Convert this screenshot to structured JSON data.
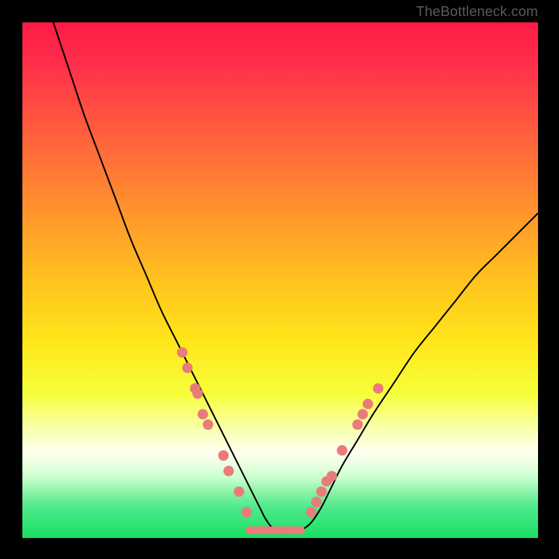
{
  "watermark": "TheBottleneck.com",
  "colors": {
    "frame": "#000000",
    "curve": "#000000",
    "dot_fill": "#e97c7a",
    "dot_stroke": "#d96a68",
    "gradient_stops": [
      {
        "offset": 0.0,
        "color": "#ff1a46"
      },
      {
        "offset": 0.08,
        "color": "#ff2f4a"
      },
      {
        "offset": 0.2,
        "color": "#ff5a3f"
      },
      {
        "offset": 0.35,
        "color": "#ff8e2e"
      },
      {
        "offset": 0.5,
        "color": "#ffc21e"
      },
      {
        "offset": 0.62,
        "color": "#ffe61a"
      },
      {
        "offset": 0.72,
        "color": "#f6ff3a"
      },
      {
        "offset": 0.8,
        "color": "#f9ffc0"
      },
      {
        "offset": 0.835,
        "color": "#fdfff0"
      },
      {
        "offset": 0.86,
        "color": "#e8ffe0"
      },
      {
        "offset": 0.885,
        "color": "#c4ffcc"
      },
      {
        "offset": 0.91,
        "color": "#8cf3a8"
      },
      {
        "offset": 0.94,
        "color": "#4fe98c"
      },
      {
        "offset": 1.0,
        "color": "#18e061"
      }
    ]
  },
  "chart_data": {
    "type": "line",
    "title": "",
    "xlabel": "",
    "ylabel": "",
    "xlim": [
      0,
      100
    ],
    "ylim": [
      0,
      100
    ],
    "series": [
      {
        "name": "bottleneck-curve",
        "x": [
          6,
          8,
          10,
          12,
          15,
          18,
          21,
          24,
          27,
          30,
          33,
          36,
          38,
          40,
          42,
          44,
          46,
          47,
          48,
          49,
          50,
          52,
          54,
          56,
          58,
          60,
          62,
          65,
          68,
          72,
          76,
          80,
          84,
          88,
          92,
          96,
          100
        ],
        "y": [
          100,
          94,
          88,
          82,
          74,
          66,
          58,
          51,
          44,
          38,
          32,
          26,
          22,
          18,
          14,
          10,
          6,
          4,
          2.5,
          1.5,
          1,
          1,
          1.5,
          3,
          6,
          10,
          14,
          19,
          24,
          30,
          36,
          41,
          46,
          51,
          55,
          59,
          63
        ]
      }
    ],
    "flat_region": {
      "x_start": 44,
      "x_end": 54,
      "y": 1.5
    },
    "dots_left": [
      {
        "x": 31,
        "y": 36
      },
      {
        "x": 32,
        "y": 33
      },
      {
        "x": 33.5,
        "y": 29
      },
      {
        "x": 34,
        "y": 28
      },
      {
        "x": 35,
        "y": 24
      },
      {
        "x": 36,
        "y": 22
      },
      {
        "x": 39,
        "y": 16
      },
      {
        "x": 40,
        "y": 13
      },
      {
        "x": 42,
        "y": 9
      },
      {
        "x": 43.5,
        "y": 5
      }
    ],
    "dots_right": [
      {
        "x": 56,
        "y": 5
      },
      {
        "x": 57,
        "y": 7
      },
      {
        "x": 58,
        "y": 9
      },
      {
        "x": 59,
        "y": 11
      },
      {
        "x": 60,
        "y": 12
      },
      {
        "x": 62,
        "y": 17
      },
      {
        "x": 65,
        "y": 22
      },
      {
        "x": 66,
        "y": 24
      },
      {
        "x": 67,
        "y": 26
      },
      {
        "x": 69,
        "y": 29
      }
    ]
  }
}
